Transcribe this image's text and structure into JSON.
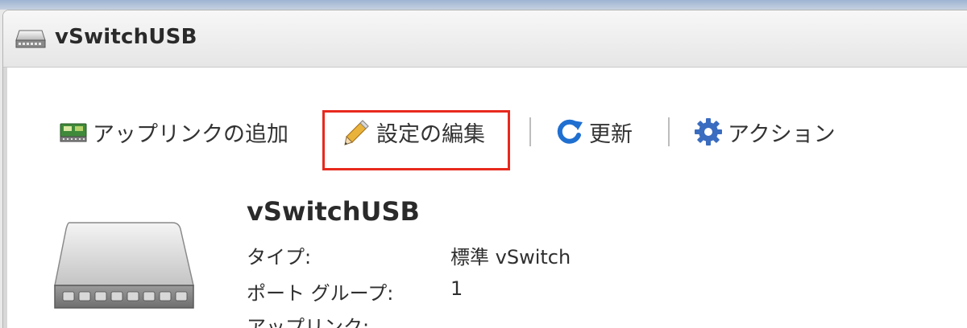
{
  "window": {
    "title": "vSwitchUSB",
    "title_icon": "network-switch-icon"
  },
  "toolbar": {
    "items": [
      {
        "label": "アップリンクの追加",
        "icon": "add-uplink-icon"
      },
      {
        "label": "設定の編集",
        "icon": "pencil-icon",
        "highlighted": true
      },
      {
        "label": "更新",
        "icon": "refresh-icon"
      },
      {
        "label": "アクション",
        "icon": "gear-icon"
      }
    ]
  },
  "details": {
    "name": "vSwitchUSB",
    "rows": [
      {
        "label": "タイプ:",
        "value": "標準 vSwitch"
      },
      {
        "label": "ポート グループ:",
        "value": "1"
      },
      {
        "label": "アップリンク:",
        "value": ""
      }
    ]
  },
  "colors": {
    "highlight": "#e8291d",
    "refresh_blue": "#1f6fd1",
    "gear_blue": "#3a6cc0"
  }
}
